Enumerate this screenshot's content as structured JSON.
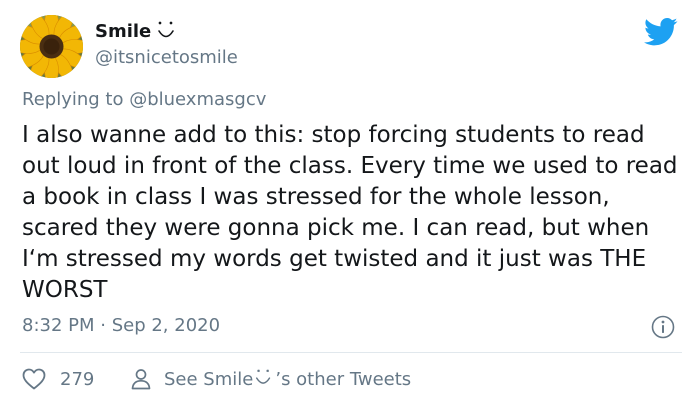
{
  "tweet": {
    "display_name": "Smile",
    "name_emoji": "smiling-face-emoji",
    "handle": "@itsnicetosmile",
    "reply_prefix": "Replying to",
    "reply_to": "@bluexmasgcv",
    "body": "I also wanne add to this: stop forcing students to read out loud in front of the class. Every time we used to read a book in class I was stressed for the whole lesson, scared they were gonna pick me. I can read, but when I‘m stressed my words get twisted and it just was THE WORST",
    "timestamp": "8:32 PM · Sep 2, 2020",
    "like_count": "279",
    "see_more_prefix": "See Smile",
    "see_more_suffix": "’s other Tweets"
  },
  "icons": {
    "brand": "twitter-bird-icon",
    "like": "heart-icon",
    "profile": "person-icon",
    "info": "info-icon"
  },
  "colors": {
    "text": "#14171a",
    "secondary_text": "#657786",
    "twitter_blue": "#1da1f2",
    "divider": "#e1e8ed"
  }
}
